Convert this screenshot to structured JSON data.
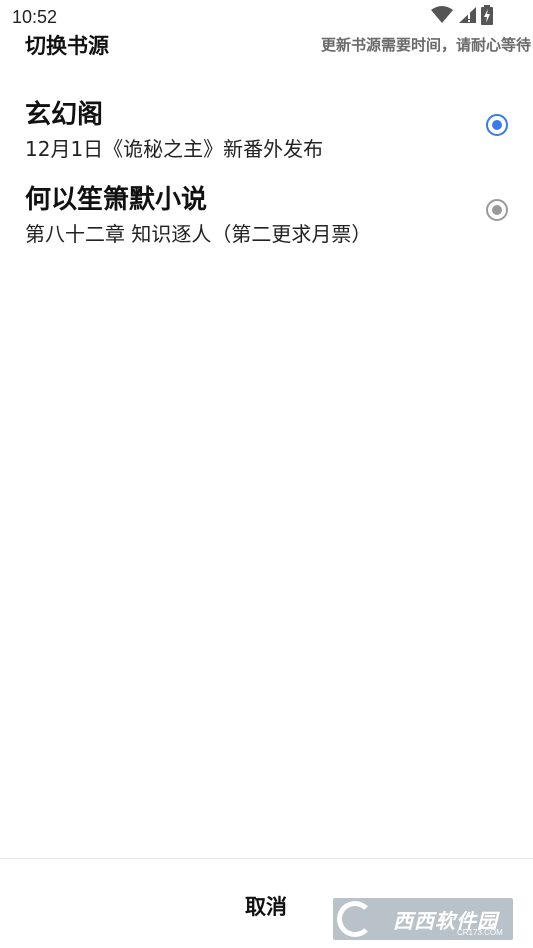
{
  "status_bar": {
    "time": "10:52",
    "icons": [
      "wifi-icon",
      "signal-icon",
      "battery-icon"
    ]
  },
  "dialog": {
    "title": "切换书源",
    "hint": "更新书源需要时间，请耐心等待"
  },
  "sources": [
    {
      "name": "玄幻阁",
      "latest": "12月1日《诡秘之主》新番外发布",
      "selected": true
    },
    {
      "name": "何以笙箫默小说",
      "latest": "第八十二章 知识逐人（第二更求月票）",
      "selected": false
    }
  ],
  "footer": {
    "cancel_label": "取消"
  },
  "watermark": {
    "text": "西西软件园",
    "sub": "CR173.COM"
  },
  "colors": {
    "accent": "#3b7be3",
    "radio_inactive": "#9a9a9a",
    "hint": "#6a6a6a"
  }
}
